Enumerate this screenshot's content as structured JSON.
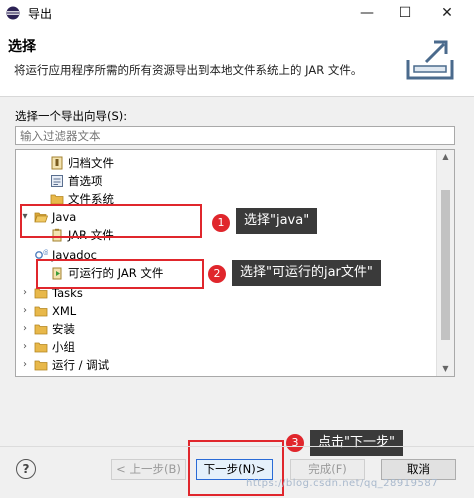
{
  "window": {
    "title": "导出",
    "minimize": "—",
    "maximize": "☐",
    "close": "✕"
  },
  "header": {
    "title": "选择",
    "description": "将运行应用程序所需的所有资源导出到本地文件系统上的 JAR 文件。"
  },
  "wizard": {
    "label": "选择一个导出向导(S):",
    "filter_placeholder": "输入过滤器文本"
  },
  "tree": {
    "items": [
      {
        "label": "归档文件",
        "icon": "archive-icon",
        "expanded": null
      },
      {
        "label": "首选项",
        "icon": "preferences-icon",
        "expanded": null
      },
      {
        "label": "文件系统",
        "icon": "folder-icon",
        "expanded": null
      },
      {
        "label": "Java",
        "icon": "folder-open-icon",
        "expanded": true
      },
      {
        "label": "JAR 文件",
        "icon": "jar-icon",
        "expanded": null
      },
      {
        "label": "Javadoc",
        "icon": "javadoc-icon",
        "expanded": null
      },
      {
        "label": "可运行的 JAR 文件",
        "icon": "runnable-jar-icon",
        "expanded": null,
        "selected": true
      },
      {
        "label": "Tasks",
        "icon": "folder-icon",
        "expanded": false
      },
      {
        "label": "XML",
        "icon": "folder-icon",
        "expanded": false
      },
      {
        "label": "安装",
        "icon": "folder-icon",
        "expanded": false
      },
      {
        "label": "小组",
        "icon": "folder-icon",
        "expanded": false
      },
      {
        "label": "运行 / 调试",
        "icon": "folder-icon",
        "expanded": false
      }
    ]
  },
  "annotations": [
    {
      "number": "1",
      "text": "选择\"java\""
    },
    {
      "number": "2",
      "text": "选择\"可运行的jar文件\""
    },
    {
      "number": "3",
      "text": "点击\"下一步\""
    }
  ],
  "buttons": {
    "help": "?",
    "back": "< 上一步(B)",
    "next": "下一步(N)>",
    "finish": "完成(F)",
    "cancel": "取消"
  },
  "watermark": "https://blog.csdn.net/qq_28919587",
  "colors": {
    "annotation_red": "#e0262c",
    "callout_bg": "#3a3a3a",
    "folder_yellow": "#e8b84a"
  }
}
